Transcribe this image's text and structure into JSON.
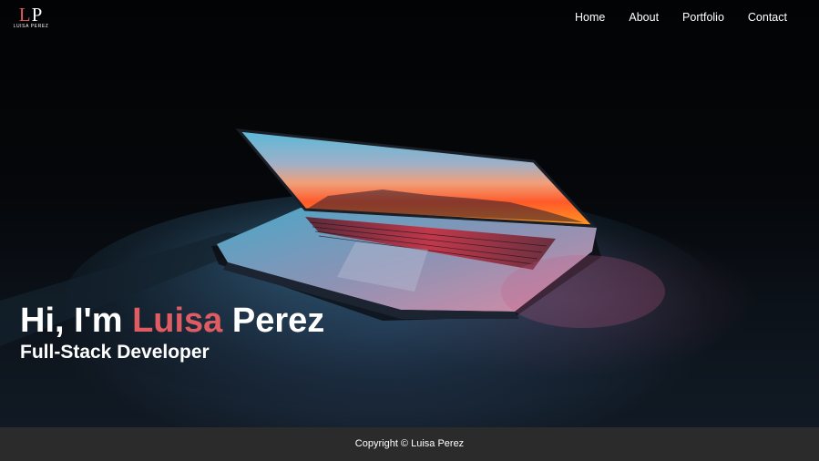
{
  "logo": {
    "mark_left": "L",
    "mark_right": "P",
    "name": "LUISA PEREZ"
  },
  "nav": {
    "items": [
      {
        "label": "Home"
      },
      {
        "label": "About"
      },
      {
        "label": "Portfolio"
      },
      {
        "label": "Contact"
      }
    ]
  },
  "hero": {
    "headline_prefix": "Hi, I'm ",
    "headline_accent": "Luisa",
    "headline_suffix": " Perez",
    "subtitle": "Full-Stack Developer",
    "image": "laptop-photo",
    "accent_color": "#e05c63"
  },
  "footer": {
    "text": "Copyright © Luisa Perez",
    "background": "#2b2b2b"
  }
}
